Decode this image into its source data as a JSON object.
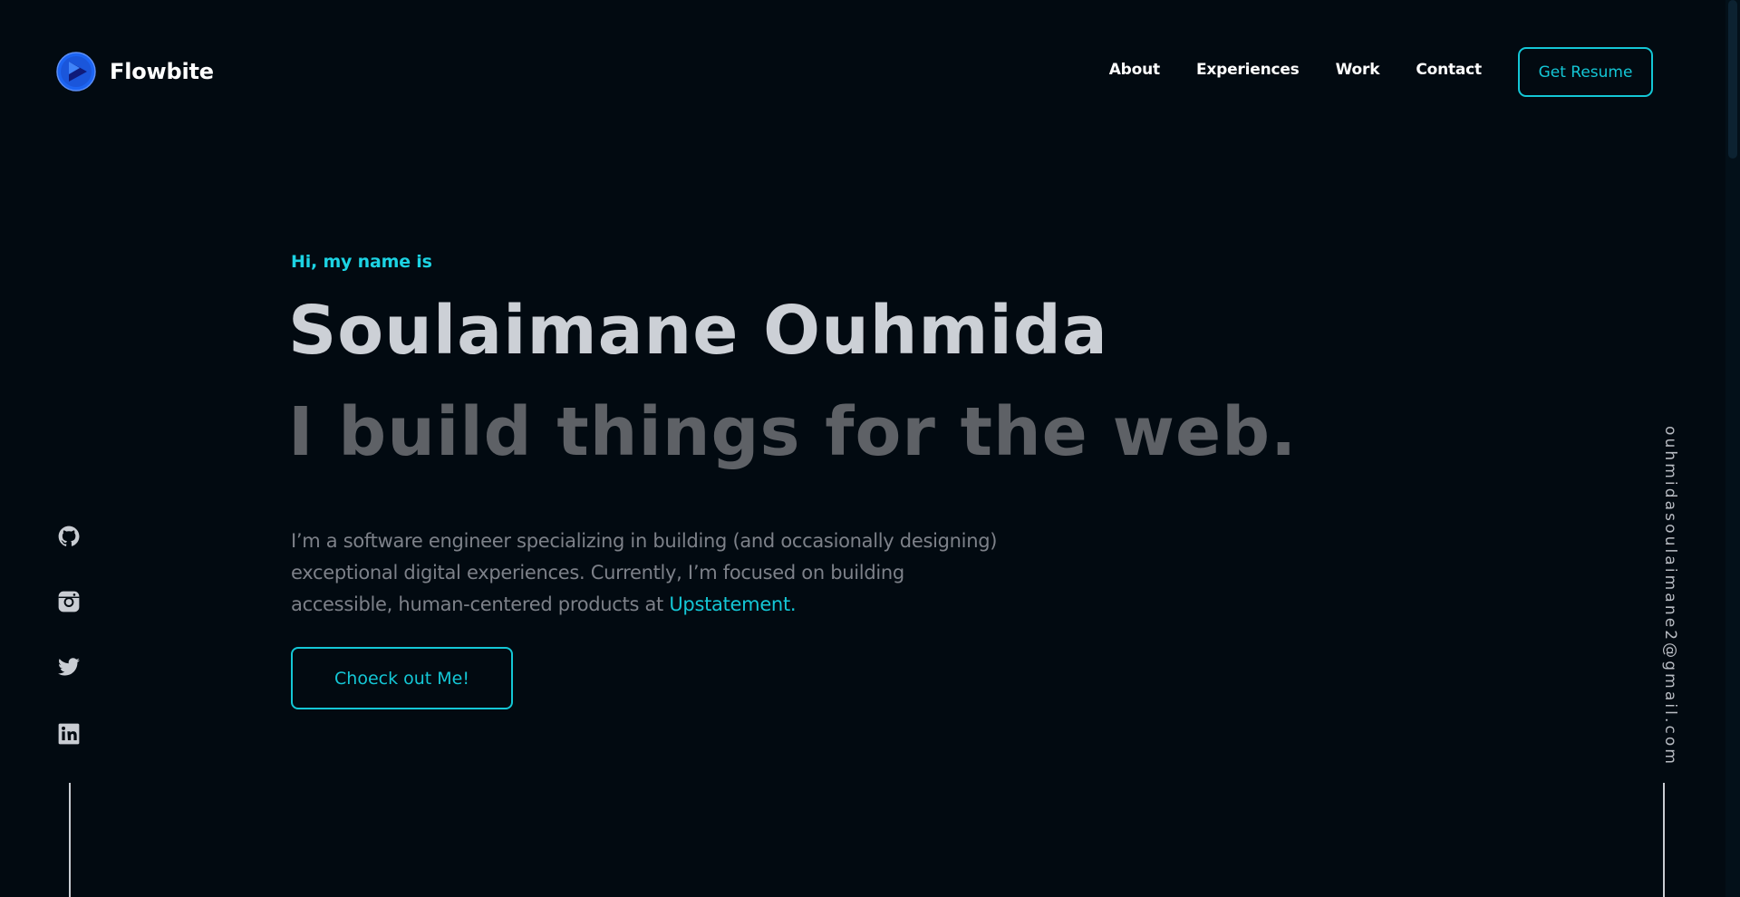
{
  "header": {
    "brand_name": "Flowbite",
    "nav": [
      {
        "label": "About"
      },
      {
        "label": "Experiences"
      },
      {
        "label": "Work"
      },
      {
        "label": "Contact"
      }
    ],
    "resume_label": "Get Resume"
  },
  "hero": {
    "intro": "Hi, my name is",
    "name": "Soulaimane Ouhmida",
    "tagline": "I build things for the web.",
    "description_lines": [
      "I’m a software engineer specializing in building (and occasionally designing)",
      "exceptional digital experiences. Currently, I’m focused on building",
      "accessible, human-centered products at "
    ],
    "company": "Upstatement.",
    "cta_label": "Choeck out Me!"
  },
  "social": [
    {
      "icon": "github-icon"
    },
    {
      "icon": "instagram-icon"
    },
    {
      "icon": "twitter-icon"
    },
    {
      "icon": "linkedin-icon"
    }
  ],
  "email": "ouhmidasoulaimane2@gmail.com",
  "colors": {
    "background": "#020a11",
    "accent": "#14c7d6",
    "heading": "#ccd0d6",
    "tagline": "#5e6166",
    "body_text": "#7d8189"
  }
}
